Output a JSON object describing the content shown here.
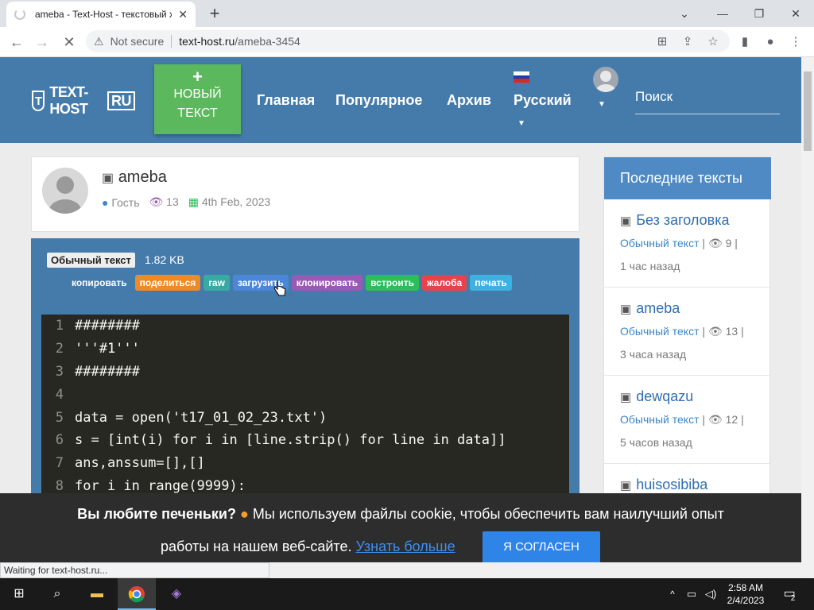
{
  "browser": {
    "tab_title": "ameba - Text-Host - текстовый х",
    "not_secure": "Not secure",
    "url_host": "text-host.ru",
    "url_path": "/ameba-3454"
  },
  "site": {
    "logo_text": "TEXT-HOST",
    "logo_ru": "RU",
    "new_text_label": "НОВЫЙ ТЕКСТ",
    "nav": [
      "Главная",
      "Популярное",
      "Архив",
      "Русский"
    ],
    "search_placeholder": "Поиск"
  },
  "paste": {
    "title": "ameba",
    "author": "Гость",
    "views": "13",
    "date": "4th Feb, 2023",
    "type": "Обычный текст",
    "size": "1.82 KB",
    "actions": [
      {
        "label": "копировать",
        "color": "#457bab"
      },
      {
        "label": "поделиться",
        "color": "#f08a24"
      },
      {
        "label": "raw",
        "color": "#39a9a4"
      },
      {
        "label": "загрузить",
        "color": "#4c86d6"
      },
      {
        "label": "клонировать",
        "color": "#9b59b6"
      },
      {
        "label": "встроить",
        "color": "#2ebd59"
      },
      {
        "label": "жалоба",
        "color": "#e8424c"
      },
      {
        "label": "печать",
        "color": "#3fb1e0"
      }
    ],
    "code_lines": [
      {
        "n": "1",
        "text": "########"
      },
      {
        "n": "2",
        "text": "'''#1'''"
      },
      {
        "n": "3",
        "text": "########"
      },
      {
        "n": "4",
        "text": ""
      },
      {
        "n": "5",
        "text": "data = open('t17_01_02_23.txt')"
      },
      {
        "n": "6",
        "text": "s = [int(i) for i in [line.strip() for line in data]]"
      },
      {
        "n": "7",
        "text": "ans,anssum=[],[]"
      },
      {
        "n": "8",
        "text": "for i in range(9999):"
      }
    ]
  },
  "sidebar": {
    "heading": "Последние тексты",
    "items": [
      {
        "title": "Без заголовка",
        "type": "Обычный текст",
        "views": "9",
        "time": "1 час назад"
      },
      {
        "title": "ameba",
        "type": "Обычный текст",
        "views": "13",
        "time": "3 часа назад"
      },
      {
        "title": "dewqazu",
        "type": "Обычный текст",
        "views": "12",
        "time": "5 часов назад"
      },
      {
        "title": "huisosibiba",
        "type": "",
        "views": "",
        "time": ""
      }
    ]
  },
  "cookie": {
    "question": "Вы любите печеньки?",
    "message_1": "Мы используем файлы cookie, чтобы обеспечить вам наилучший опыт",
    "message_2": "работы на нашем веб-сайте.",
    "learn_more": "Узнать больше",
    "agree": "Я СОГЛАСЕН"
  },
  "status_bar": "Waiting for text-host.ru...",
  "taskbar": {
    "time": "2:58 AM",
    "date": "2/4/2023",
    "notifications": "2"
  }
}
